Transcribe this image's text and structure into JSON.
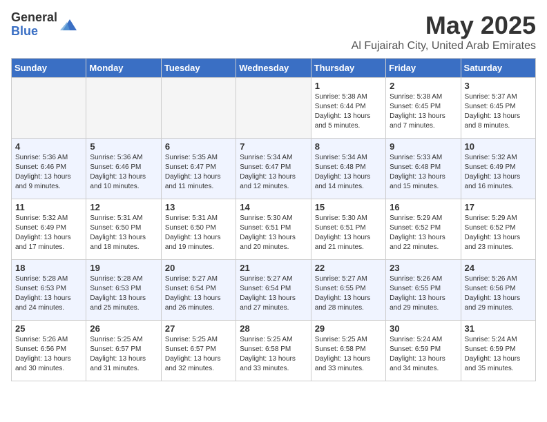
{
  "logo": {
    "general": "General",
    "blue": "Blue"
  },
  "title": {
    "month": "May 2025",
    "location": "Al Fujairah City, United Arab Emirates"
  },
  "headers": [
    "Sunday",
    "Monday",
    "Tuesday",
    "Wednesday",
    "Thursday",
    "Friday",
    "Saturday"
  ],
  "weeks": [
    [
      {
        "day": "",
        "info": "",
        "empty": true
      },
      {
        "day": "",
        "info": "",
        "empty": true
      },
      {
        "day": "",
        "info": "",
        "empty": true
      },
      {
        "day": "",
        "info": "",
        "empty": true
      },
      {
        "day": "1",
        "info": "Sunrise: 5:38 AM\nSunset: 6:44 PM\nDaylight: 13 hours\nand 5 minutes.",
        "empty": false
      },
      {
        "day": "2",
        "info": "Sunrise: 5:38 AM\nSunset: 6:45 PM\nDaylight: 13 hours\nand 7 minutes.",
        "empty": false
      },
      {
        "day": "3",
        "info": "Sunrise: 5:37 AM\nSunset: 6:45 PM\nDaylight: 13 hours\nand 8 minutes.",
        "empty": false
      }
    ],
    [
      {
        "day": "4",
        "info": "Sunrise: 5:36 AM\nSunset: 6:46 PM\nDaylight: 13 hours\nand 9 minutes.",
        "empty": false
      },
      {
        "day": "5",
        "info": "Sunrise: 5:36 AM\nSunset: 6:46 PM\nDaylight: 13 hours\nand 10 minutes.",
        "empty": false
      },
      {
        "day": "6",
        "info": "Sunrise: 5:35 AM\nSunset: 6:47 PM\nDaylight: 13 hours\nand 11 minutes.",
        "empty": false
      },
      {
        "day": "7",
        "info": "Sunrise: 5:34 AM\nSunset: 6:47 PM\nDaylight: 13 hours\nand 12 minutes.",
        "empty": false
      },
      {
        "day": "8",
        "info": "Sunrise: 5:34 AM\nSunset: 6:48 PM\nDaylight: 13 hours\nand 14 minutes.",
        "empty": false
      },
      {
        "day": "9",
        "info": "Sunrise: 5:33 AM\nSunset: 6:48 PM\nDaylight: 13 hours\nand 15 minutes.",
        "empty": false
      },
      {
        "day": "10",
        "info": "Sunrise: 5:32 AM\nSunset: 6:49 PM\nDaylight: 13 hours\nand 16 minutes.",
        "empty": false
      }
    ],
    [
      {
        "day": "11",
        "info": "Sunrise: 5:32 AM\nSunset: 6:49 PM\nDaylight: 13 hours\nand 17 minutes.",
        "empty": false
      },
      {
        "day": "12",
        "info": "Sunrise: 5:31 AM\nSunset: 6:50 PM\nDaylight: 13 hours\nand 18 minutes.",
        "empty": false
      },
      {
        "day": "13",
        "info": "Sunrise: 5:31 AM\nSunset: 6:50 PM\nDaylight: 13 hours\nand 19 minutes.",
        "empty": false
      },
      {
        "day": "14",
        "info": "Sunrise: 5:30 AM\nSunset: 6:51 PM\nDaylight: 13 hours\nand 20 minutes.",
        "empty": false
      },
      {
        "day": "15",
        "info": "Sunrise: 5:30 AM\nSunset: 6:51 PM\nDaylight: 13 hours\nand 21 minutes.",
        "empty": false
      },
      {
        "day": "16",
        "info": "Sunrise: 5:29 AM\nSunset: 6:52 PM\nDaylight: 13 hours\nand 22 minutes.",
        "empty": false
      },
      {
        "day": "17",
        "info": "Sunrise: 5:29 AM\nSunset: 6:52 PM\nDaylight: 13 hours\nand 23 minutes.",
        "empty": false
      }
    ],
    [
      {
        "day": "18",
        "info": "Sunrise: 5:28 AM\nSunset: 6:53 PM\nDaylight: 13 hours\nand 24 minutes.",
        "empty": false
      },
      {
        "day": "19",
        "info": "Sunrise: 5:28 AM\nSunset: 6:53 PM\nDaylight: 13 hours\nand 25 minutes.",
        "empty": false
      },
      {
        "day": "20",
        "info": "Sunrise: 5:27 AM\nSunset: 6:54 PM\nDaylight: 13 hours\nand 26 minutes.",
        "empty": false
      },
      {
        "day": "21",
        "info": "Sunrise: 5:27 AM\nSunset: 6:54 PM\nDaylight: 13 hours\nand 27 minutes.",
        "empty": false
      },
      {
        "day": "22",
        "info": "Sunrise: 5:27 AM\nSunset: 6:55 PM\nDaylight: 13 hours\nand 28 minutes.",
        "empty": false
      },
      {
        "day": "23",
        "info": "Sunrise: 5:26 AM\nSunset: 6:55 PM\nDaylight: 13 hours\nand 29 minutes.",
        "empty": false
      },
      {
        "day": "24",
        "info": "Sunrise: 5:26 AM\nSunset: 6:56 PM\nDaylight: 13 hours\nand 29 minutes.",
        "empty": false
      }
    ],
    [
      {
        "day": "25",
        "info": "Sunrise: 5:26 AM\nSunset: 6:56 PM\nDaylight: 13 hours\nand 30 minutes.",
        "empty": false
      },
      {
        "day": "26",
        "info": "Sunrise: 5:25 AM\nSunset: 6:57 PM\nDaylight: 13 hours\nand 31 minutes.",
        "empty": false
      },
      {
        "day": "27",
        "info": "Sunrise: 5:25 AM\nSunset: 6:57 PM\nDaylight: 13 hours\nand 32 minutes.",
        "empty": false
      },
      {
        "day": "28",
        "info": "Sunrise: 5:25 AM\nSunset: 6:58 PM\nDaylight: 13 hours\nand 33 minutes.",
        "empty": false
      },
      {
        "day": "29",
        "info": "Sunrise: 5:25 AM\nSunset: 6:58 PM\nDaylight: 13 hours\nand 33 minutes.",
        "empty": false
      },
      {
        "day": "30",
        "info": "Sunrise: 5:24 AM\nSunset: 6:59 PM\nDaylight: 13 hours\nand 34 minutes.",
        "empty": false
      },
      {
        "day": "31",
        "info": "Sunrise: 5:24 AM\nSunset: 6:59 PM\nDaylight: 13 hours\nand 35 minutes.",
        "empty": false
      }
    ]
  ],
  "week_bg": [
    "odd-week",
    "even-week",
    "odd-week",
    "even-week",
    "odd-week"
  ]
}
